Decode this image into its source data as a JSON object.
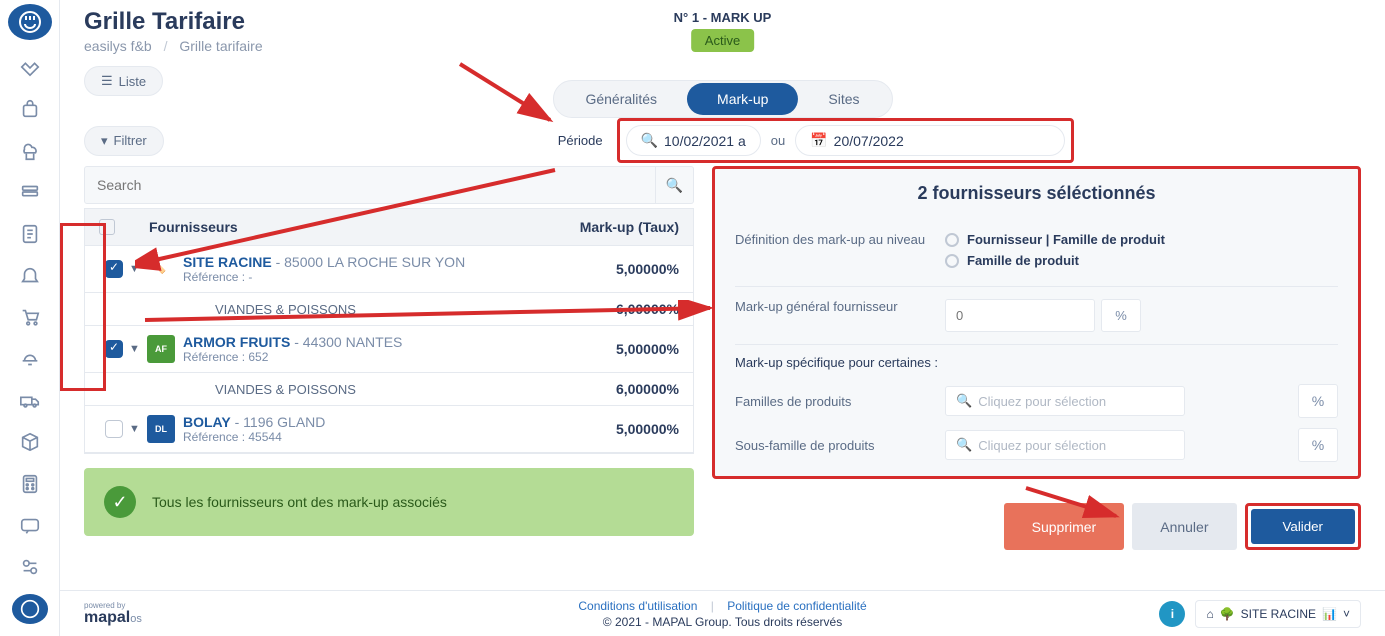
{
  "header": {
    "title": "Grille Tarifaire",
    "breadcrumb_root": "easilys f&b",
    "breadcrumb_current": "Grille tarifaire",
    "reference": "N° 1 - MARK UP",
    "status": "Active"
  },
  "toolbar": {
    "liste_label": "Liste",
    "filtrer_label": "Filtrer",
    "periode_label": "Période",
    "periode_start": "10/02/2021 a",
    "periode_sep": "ou",
    "periode_end": "20/07/2022"
  },
  "tabs": {
    "generalites": "Généralités",
    "markup": "Mark-up",
    "sites": "Sites"
  },
  "table": {
    "search_placeholder": "Search",
    "col_fournisseurs": "Fournisseurs",
    "col_markup": "Mark-up (Taux)",
    "rows": [
      {
        "checked": true,
        "name": "SITE RACINE",
        "addr": "85000 LA ROCHE SUR YON",
        "ref": "Référence : -",
        "markup": "5,00000%",
        "logo_txt": "🏷️",
        "logo_bg": "#fff"
      },
      {
        "sub": true,
        "subname": "VIANDES & POISSONS",
        "markup": "6,00000%"
      },
      {
        "checked": true,
        "name": "ARMOR FRUITS",
        "addr": "44300 NANTES",
        "ref": "Référence : 652",
        "markup": "5,00000%",
        "logo_txt": "AF",
        "logo_bg": "#4a9a3a"
      },
      {
        "sub": true,
        "subname": "VIANDES & POISSONS",
        "markup": "6,00000%"
      },
      {
        "checked": false,
        "name": "BOLAY",
        "addr": "1196 GLAND",
        "ref": "Référence : 45544",
        "markup": "5,00000%",
        "logo_txt": "DL",
        "logo_bg": "#1e5a9e"
      }
    ]
  },
  "banner": {
    "text": "Tous les fournisseurs ont des mark-up associés"
  },
  "right": {
    "title": "2 fournisseurs séléctionnés",
    "def_label": "Définition des mark-up au niveau",
    "opt1": "Fournisseur | Famille de produit",
    "opt2": "Famille de produit",
    "gen_label": "Mark-up général fournisseur",
    "gen_placeholder": "0",
    "pct": "%",
    "spec_title": "Mark-up spécifique pour certaines :",
    "fam_label": "Familles de produits",
    "sousfam_label": "Sous-famille de produits",
    "select_placeholder": "Cliquez pour sélection"
  },
  "actions": {
    "supprimer": "Supprimer",
    "annuler": "Annuler",
    "valider": "Valider"
  },
  "footer": {
    "powered": "powered by",
    "brand": "mapal",
    "brand_suffix": "os",
    "terms": "Conditions d'utilisation",
    "privacy": "Politique de confidentialité",
    "copyright": "© 2021 - MAPAL Group. Tous droits réservés",
    "site": "SITE RACINE"
  }
}
